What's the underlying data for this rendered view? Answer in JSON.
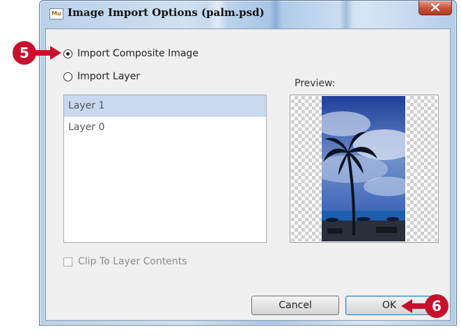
{
  "window": {
    "title": "Image Import Options (palm.psd)",
    "app_icon_text": "Mu"
  },
  "options": {
    "composite_label": "Import Composite Image",
    "composite_selected": true,
    "layer_label": "Import Layer",
    "layer_selected": false
  },
  "layers": {
    "items": [
      "Layer 1",
      "Layer 0"
    ],
    "selected_index": 0
  },
  "preview": {
    "label": "Preview:"
  },
  "clip": {
    "label": "Clip To Layer Contents",
    "checked": false,
    "enabled": false
  },
  "buttons": {
    "cancel": "Cancel",
    "ok": "OK"
  },
  "callouts": {
    "step_composite": "5",
    "step_ok": "6"
  },
  "colors": {
    "callout": "#c8102e",
    "list_selection": "#c9daf0",
    "close_button": "#c7503a"
  }
}
